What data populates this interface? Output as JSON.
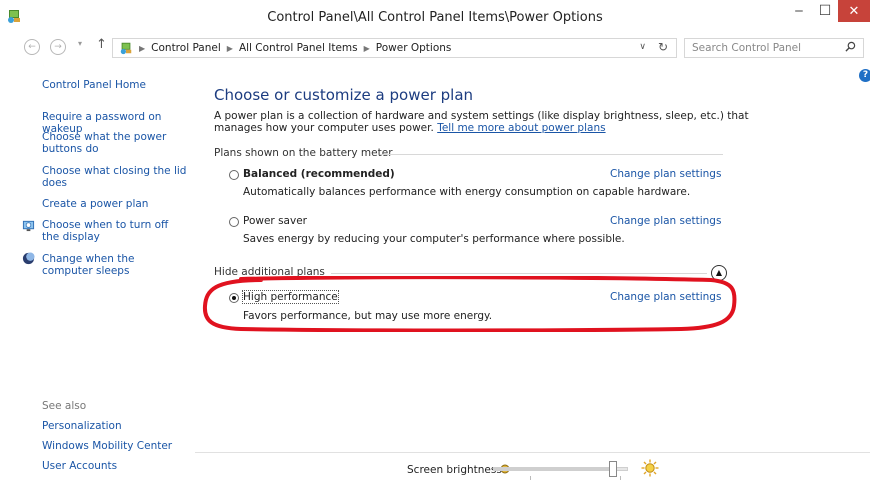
{
  "window": {
    "title": "Control Panel\\All Control Panel Items\\Power Options",
    "min_glyph": "‒",
    "max_glyph": "☐",
    "close_glyph": "✕"
  },
  "address": {
    "crumbs": [
      "Control Panel",
      "All Control Panel Items",
      "Power Options"
    ],
    "search_placeholder": "Search Control Panel"
  },
  "sidebar": {
    "home": "Control Panel Home",
    "links": [
      "Require a password on wakeup",
      "Choose what the power buttons do",
      "Choose what closing the lid does",
      "Create a power plan",
      "Choose when to turn off the display",
      "Change when the computer sleeps"
    ],
    "see_also_heading": "See also",
    "see_also": [
      "Personalization",
      "Windows Mobility Center",
      "User Accounts"
    ]
  },
  "main": {
    "title": "Choose or customize a power plan",
    "description": "A power plan is a collection of hardware and system settings (like display brightness, sleep, etc.) that manages how your computer uses power.",
    "tell_more_link": "Tell me more about power plans",
    "battery_group_label": "Plans shown on the battery meter",
    "additional_group_label": "Hide additional plans",
    "change_label": "Change plan settings",
    "plans": [
      {
        "name": "Balanced (recommended)",
        "desc": "Automatically balances performance with energy consumption on capable hardware.",
        "selected": false,
        "bold": true
      },
      {
        "name": "Power saver",
        "desc": "Saves energy by reducing your computer's performance where possible.",
        "selected": false,
        "bold": false
      },
      {
        "name": "High performance",
        "desc": "Favors performance, but may use more energy.",
        "selected": true,
        "bold": false
      }
    ]
  },
  "bottom": {
    "brightness_label": "Screen brightness:",
    "brightness_level": 0.92
  },
  "colors": {
    "link": "#1a55a6",
    "heading": "#1c3c80",
    "close_button": "#c7433a",
    "highlight_annotation": "#e0121f"
  }
}
